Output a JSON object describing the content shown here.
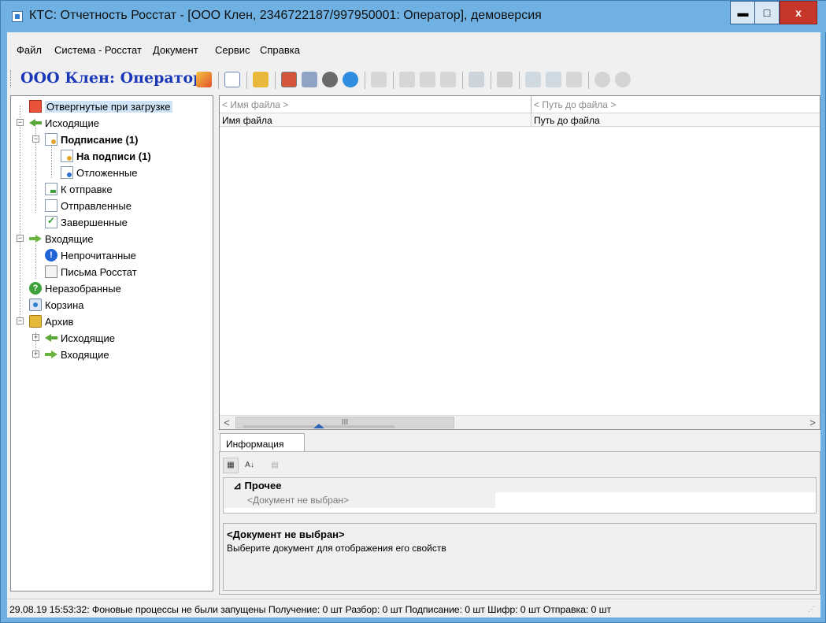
{
  "window": {
    "title": "КТС: Отчетность Росстат - [ООО Клен, 2346722187/997950001: Оператор], демоверсия",
    "minimize_glyph": "▬",
    "maximize_glyph": "□",
    "close_glyph": "x"
  },
  "menu": [
    "Файл",
    "Система - Росстат",
    "Документ",
    "Сервис",
    "Справка"
  ],
  "toolbar": {
    "org_label": "ООО Клен: Оператор"
  },
  "tree": {
    "items": [
      {
        "label": "Отвергнутые при загрузке",
        "icon": "rejected-icon"
      },
      {
        "label": "Исходящие",
        "icon": "outgoing-arrow-icon"
      },
      {
        "label": "Подписание (1)",
        "icon": "document-sign-icon"
      },
      {
        "label": "На подписи (1)",
        "icon": "document-pending-icon"
      },
      {
        "label": "Отложенные",
        "icon": "document-deferred-icon"
      },
      {
        "label": "К отправке",
        "icon": "document-to-send-icon"
      },
      {
        "label": "Отправленные",
        "icon": "document-sent-icon"
      },
      {
        "label": "Завершенные",
        "icon": "document-completed-icon"
      },
      {
        "label": "Входящие",
        "icon": "incoming-arrow-icon"
      },
      {
        "label": "Непрочитанные",
        "icon": "info-icon"
      },
      {
        "label": "Письма Росстат",
        "icon": "letter-icon"
      },
      {
        "label": "Неразобранные",
        "icon": "unsorted-icon"
      },
      {
        "label": "Корзина",
        "icon": "trash-icon"
      },
      {
        "label": "Архив",
        "icon": "archive-box-icon"
      },
      {
        "label": "Исходящие",
        "icon": "outgoing-arrow-icon"
      },
      {
        "label": "Входящие",
        "icon": "incoming-arrow-icon"
      }
    ]
  },
  "grid": {
    "filter_placeholders": [
      "< Имя файла >",
      "< Путь до файла >"
    ],
    "columns": [
      "Имя файла",
      "Путь до файла"
    ],
    "scroll_left": "<",
    "scroll_right": ">",
    "thumb_glyph": "III"
  },
  "info": {
    "tab_label": "Информация",
    "category": "Прочее",
    "category_glyph": "⊿",
    "property_value": "<Документ не выбран>",
    "desc_title": "<Документ не выбран>",
    "desc_text": "Выберите документ для отображения его свойств"
  },
  "status": {
    "text": "29.08.19 15:53:32: Фоновые процессы не были запущены  Получение: 0 шт  Разбор: 0 шт  Подписание: 0 шт  Шифр: 0 шт  Отправка: 0 шт"
  },
  "colors": {
    "title_bar": "#6fb1e3",
    "org_label": "#1b38b8",
    "close_button": "#c7362b"
  }
}
